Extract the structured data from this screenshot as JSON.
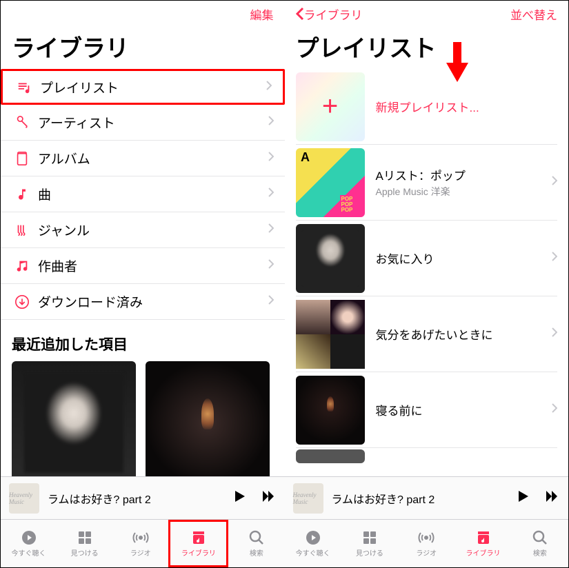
{
  "left": {
    "top_action": "編集",
    "title": "ライブラリ",
    "rows": [
      {
        "icon": "playlist",
        "label": "プレイリスト",
        "highlight": true
      },
      {
        "icon": "mic",
        "label": "アーティスト"
      },
      {
        "icon": "album",
        "label": "アルバム"
      },
      {
        "icon": "note",
        "label": "曲"
      },
      {
        "icon": "guitar",
        "label": "ジャンル"
      },
      {
        "icon": "notes",
        "label": "作曲者"
      },
      {
        "icon": "download",
        "label": "ダウンロード済み"
      }
    ],
    "section": "最近追加した項目"
  },
  "right": {
    "back": "ライブラリ",
    "top_action": "並べ替え",
    "title": "プレイリスト",
    "new_label": "新規プレイリスト...",
    "items": [
      {
        "name": "Aリスト：ポップ",
        "sub": "Apple Music 洋楽",
        "art": "alist"
      },
      {
        "name": "お気に入り",
        "sub": "",
        "art": "fav"
      },
      {
        "name": "気分をあげたいときに",
        "sub": "",
        "art": "mood"
      },
      {
        "name": "寝る前に",
        "sub": "",
        "art": "sleep"
      }
    ]
  },
  "nowplaying": {
    "title": "ラムはお好き? part 2",
    "art_text": "Heavenly Music"
  },
  "tabs": [
    {
      "id": "listen",
      "label": "今すぐ聴く"
    },
    {
      "id": "browse",
      "label": "見つける"
    },
    {
      "id": "radio",
      "label": "ラジオ"
    },
    {
      "id": "library",
      "label": "ライブラリ",
      "active": true
    },
    {
      "id": "search",
      "label": "検索"
    }
  ]
}
